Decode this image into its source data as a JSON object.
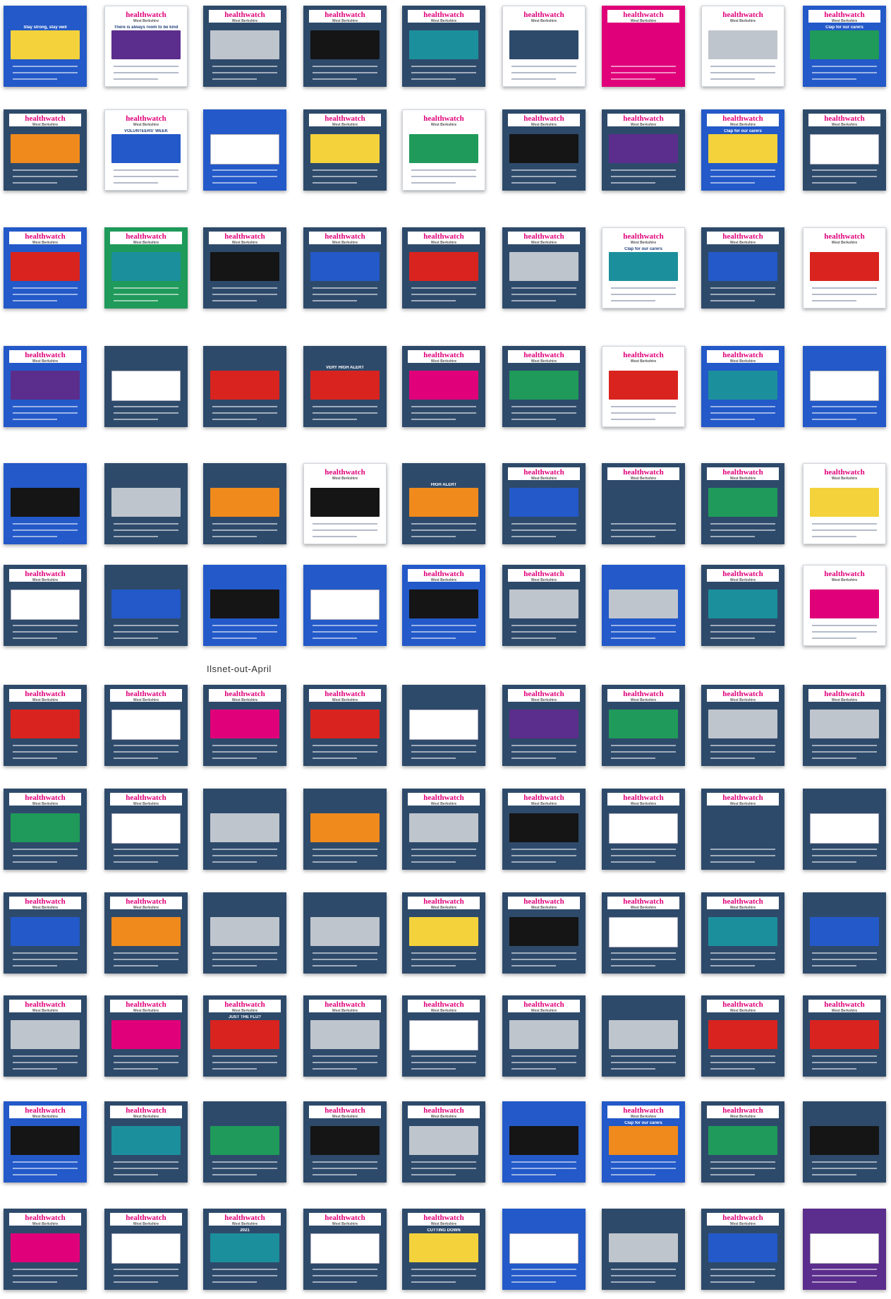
{
  "section_label": "Ilsnet-out-April",
  "brand_text": "healthwatch",
  "brand_sub": "West Berkshire",
  "colors": {
    "navy": "#2e4a6b",
    "blue": "#2359c8",
    "white": "#ffffff",
    "pink": "#e0007a",
    "green": "#1f9a5a",
    "purple": "#5b2d8c",
    "red": "#d9231f",
    "orange": "#f08a1c",
    "yellow": "#f3d23b",
    "teal": "#1c8f9c",
    "dark": "#151515",
    "grey": "#bfc5cc"
  },
  "rows": [
    [
      {
        "bg": "blue",
        "img": "yellow",
        "hdr": false,
        "cap": "Stay strong, stay well"
      },
      {
        "bg": "white",
        "img": "purple",
        "hdr": true,
        "cap": "There is always room to be kind"
      },
      {
        "bg": "navy",
        "img": "grey",
        "hdr": true,
        "cap": ""
      },
      {
        "bg": "navy",
        "img": "dark",
        "hdr": true,
        "cap": ""
      },
      {
        "bg": "navy",
        "img": "teal",
        "hdr": true,
        "cap": ""
      },
      {
        "bg": "white",
        "img": "navy",
        "hdr": true,
        "cap": ""
      },
      {
        "bg": "pink",
        "img": "pink",
        "hdr": true,
        "cap": ""
      },
      {
        "bg": "white",
        "img": "grey",
        "hdr": true,
        "cap": ""
      },
      {
        "bg": "blue",
        "img": "green",
        "hdr": true,
        "cap": "Clap for our carers"
      }
    ],
    [
      {
        "bg": "navy",
        "img": "orange",
        "hdr": true,
        "cap": ""
      },
      {
        "bg": "white",
        "img": "blue",
        "hdr": true,
        "cap": "VOLUNTEERS' WEEK"
      },
      {
        "bg": "blue",
        "img": "white",
        "hdr": false,
        "cap": ""
      },
      {
        "bg": "navy",
        "img": "yellow",
        "hdr": true,
        "cap": ""
      },
      {
        "bg": "white",
        "img": "green",
        "hdr": true,
        "cap": ""
      },
      {
        "bg": "navy",
        "img": "dark",
        "hdr": true,
        "cap": ""
      },
      {
        "bg": "navy",
        "img": "purple",
        "hdr": true,
        "cap": ""
      },
      {
        "bg": "blue",
        "img": "yellow",
        "hdr": true,
        "cap": "Clap for our carers"
      },
      {
        "bg": "navy",
        "img": "white",
        "hdr": true,
        "cap": ""
      }
    ],
    [
      {
        "bg": "blue",
        "img": "red",
        "hdr": true,
        "cap": ""
      },
      {
        "bg": "green",
        "img": "teal",
        "hdr": true,
        "cap": ""
      },
      {
        "bg": "navy",
        "img": "dark",
        "hdr": true,
        "cap": ""
      },
      {
        "bg": "navy",
        "img": "blue",
        "hdr": true,
        "cap": ""
      },
      {
        "bg": "navy",
        "img": "red",
        "hdr": true,
        "cap": ""
      },
      {
        "bg": "navy",
        "img": "grey",
        "hdr": true,
        "cap": ""
      },
      {
        "bg": "white",
        "img": "teal",
        "hdr": true,
        "cap": "Clap for our carers"
      },
      {
        "bg": "navy",
        "img": "blue",
        "hdr": true,
        "cap": ""
      },
      {
        "bg": "white",
        "img": "red",
        "hdr": true,
        "cap": ""
      }
    ],
    [
      {
        "bg": "blue",
        "img": "purple",
        "hdr": true,
        "cap": ""
      },
      {
        "bg": "navy",
        "img": "white",
        "hdr": false,
        "cap": ""
      },
      {
        "bg": "navy",
        "img": "red",
        "hdr": false,
        "cap": ""
      },
      {
        "bg": "navy",
        "img": "red",
        "hdr": false,
        "cap": "VERY HIGH ALERT"
      },
      {
        "bg": "navy",
        "img": "pink",
        "hdr": true,
        "cap": ""
      },
      {
        "bg": "navy",
        "img": "green",
        "hdr": true,
        "cap": ""
      },
      {
        "bg": "white",
        "img": "red",
        "hdr": true,
        "cap": ""
      },
      {
        "bg": "blue",
        "img": "teal",
        "hdr": true,
        "cap": ""
      },
      {
        "bg": "blue",
        "img": "white",
        "hdr": false,
        "cap": ""
      }
    ],
    [
      {
        "bg": "blue",
        "img": "dark",
        "hdr": false,
        "cap": ""
      },
      {
        "bg": "navy",
        "img": "grey",
        "hdr": false,
        "cap": ""
      },
      {
        "bg": "navy",
        "img": "orange",
        "hdr": false,
        "cap": ""
      },
      {
        "bg": "white",
        "img": "dark",
        "hdr": true,
        "cap": ""
      },
      {
        "bg": "navy",
        "img": "orange",
        "hdr": false,
        "cap": "HIGH ALERT"
      },
      {
        "bg": "navy",
        "img": "blue",
        "hdr": true,
        "cap": ""
      },
      {
        "bg": "navy",
        "img": "navy",
        "hdr": true,
        "cap": ""
      },
      {
        "bg": "navy",
        "img": "green",
        "hdr": true,
        "cap": ""
      },
      {
        "bg": "white",
        "img": "yellow",
        "hdr": true,
        "cap": ""
      }
    ],
    [
      {
        "bg": "navy",
        "img": "white",
        "hdr": true,
        "cap": ""
      },
      {
        "bg": "navy",
        "img": "blue",
        "hdr": false,
        "cap": ""
      },
      {
        "bg": "blue",
        "img": "dark",
        "hdr": false,
        "cap": ""
      },
      {
        "bg": "blue",
        "img": "white",
        "hdr": false,
        "cap": ""
      },
      {
        "bg": "blue",
        "img": "dark",
        "hdr": true,
        "cap": ""
      },
      {
        "bg": "navy",
        "img": "grey",
        "hdr": true,
        "cap": ""
      },
      {
        "bg": "blue",
        "img": "grey",
        "hdr": false,
        "cap": ""
      },
      {
        "bg": "navy",
        "img": "teal",
        "hdr": true,
        "cap": ""
      },
      {
        "bg": "white",
        "img": "pink",
        "hdr": true,
        "cap": ""
      }
    ],
    [
      {
        "bg": "navy",
        "img": "red",
        "hdr": true,
        "cap": ""
      },
      {
        "bg": "navy",
        "img": "white",
        "hdr": true,
        "cap": ""
      },
      {
        "bg": "navy",
        "img": "pink",
        "hdr": true,
        "cap": ""
      },
      {
        "bg": "navy",
        "img": "red",
        "hdr": true,
        "cap": ""
      },
      {
        "bg": "navy",
        "img": "white",
        "hdr": false,
        "cap": ""
      },
      {
        "bg": "navy",
        "img": "purple",
        "hdr": true,
        "cap": ""
      },
      {
        "bg": "navy",
        "img": "green",
        "hdr": true,
        "cap": ""
      },
      {
        "bg": "navy",
        "img": "grey",
        "hdr": true,
        "cap": ""
      },
      {
        "bg": "navy",
        "img": "grey",
        "hdr": true,
        "cap": ""
      }
    ],
    [
      {
        "bg": "navy",
        "img": "green",
        "hdr": true,
        "cap": ""
      },
      {
        "bg": "navy",
        "img": "white",
        "hdr": true,
        "cap": ""
      },
      {
        "bg": "navy",
        "img": "grey",
        "hdr": false,
        "cap": ""
      },
      {
        "bg": "navy",
        "img": "orange",
        "hdr": false,
        "cap": ""
      },
      {
        "bg": "navy",
        "img": "grey",
        "hdr": true,
        "cap": ""
      },
      {
        "bg": "navy",
        "img": "dark",
        "hdr": true,
        "cap": ""
      },
      {
        "bg": "navy",
        "img": "white",
        "hdr": true,
        "cap": ""
      },
      {
        "bg": "navy",
        "img": "navy",
        "hdr": true,
        "cap": ""
      },
      {
        "bg": "navy",
        "img": "white",
        "hdr": false,
        "cap": ""
      }
    ],
    [
      {
        "bg": "navy",
        "img": "blue",
        "hdr": true,
        "cap": ""
      },
      {
        "bg": "navy",
        "img": "orange",
        "hdr": true,
        "cap": ""
      },
      {
        "bg": "navy",
        "img": "grey",
        "hdr": false,
        "cap": ""
      },
      {
        "bg": "navy",
        "img": "grey",
        "hdr": false,
        "cap": ""
      },
      {
        "bg": "navy",
        "img": "yellow",
        "hdr": true,
        "cap": ""
      },
      {
        "bg": "navy",
        "img": "dark",
        "hdr": true,
        "cap": ""
      },
      {
        "bg": "navy",
        "img": "white",
        "hdr": true,
        "cap": ""
      },
      {
        "bg": "navy",
        "img": "teal",
        "hdr": true,
        "cap": ""
      },
      {
        "bg": "navy",
        "img": "blue",
        "hdr": false,
        "cap": ""
      }
    ],
    [
      {
        "bg": "navy",
        "img": "grey",
        "hdr": true,
        "cap": ""
      },
      {
        "bg": "navy",
        "img": "pink",
        "hdr": true,
        "cap": ""
      },
      {
        "bg": "navy",
        "img": "red",
        "hdr": true,
        "cap": "JUST THE FLU?"
      },
      {
        "bg": "navy",
        "img": "grey",
        "hdr": true,
        "cap": ""
      },
      {
        "bg": "navy",
        "img": "white",
        "hdr": true,
        "cap": ""
      },
      {
        "bg": "navy",
        "img": "grey",
        "hdr": true,
        "cap": ""
      },
      {
        "bg": "navy",
        "img": "grey",
        "hdr": false,
        "cap": ""
      },
      {
        "bg": "navy",
        "img": "red",
        "hdr": true,
        "cap": ""
      },
      {
        "bg": "navy",
        "img": "red",
        "hdr": true,
        "cap": ""
      }
    ],
    [
      {
        "bg": "blue",
        "img": "dark",
        "hdr": true,
        "cap": ""
      },
      {
        "bg": "navy",
        "img": "teal",
        "hdr": true,
        "cap": ""
      },
      {
        "bg": "navy",
        "img": "green",
        "hdr": false,
        "cap": ""
      },
      {
        "bg": "navy",
        "img": "dark",
        "hdr": true,
        "cap": ""
      },
      {
        "bg": "navy",
        "img": "grey",
        "hdr": true,
        "cap": ""
      },
      {
        "bg": "blue",
        "img": "dark",
        "hdr": false,
        "cap": ""
      },
      {
        "bg": "blue",
        "img": "orange",
        "hdr": true,
        "cap": "Clap for our carers"
      },
      {
        "bg": "navy",
        "img": "green",
        "hdr": true,
        "cap": ""
      },
      {
        "bg": "navy",
        "img": "dark",
        "hdr": false,
        "cap": ""
      }
    ],
    [
      {
        "bg": "navy",
        "img": "pink",
        "hdr": true,
        "cap": ""
      },
      {
        "bg": "navy",
        "img": "white",
        "hdr": true,
        "cap": ""
      },
      {
        "bg": "navy",
        "img": "teal",
        "hdr": true,
        "cap": "2021"
      },
      {
        "bg": "navy",
        "img": "white",
        "hdr": true,
        "cap": ""
      },
      {
        "bg": "navy",
        "img": "yellow",
        "hdr": true,
        "cap": "CUTTING DOWN"
      },
      {
        "bg": "blue",
        "img": "white",
        "hdr": false,
        "cap": ""
      },
      {
        "bg": "navy",
        "img": "grey",
        "hdr": false,
        "cap": ""
      },
      {
        "bg": "navy",
        "img": "blue",
        "hdr": true,
        "cap": ""
      },
      {
        "bg": "purple",
        "img": "white",
        "hdr": false,
        "cap": ""
      }
    ]
  ]
}
